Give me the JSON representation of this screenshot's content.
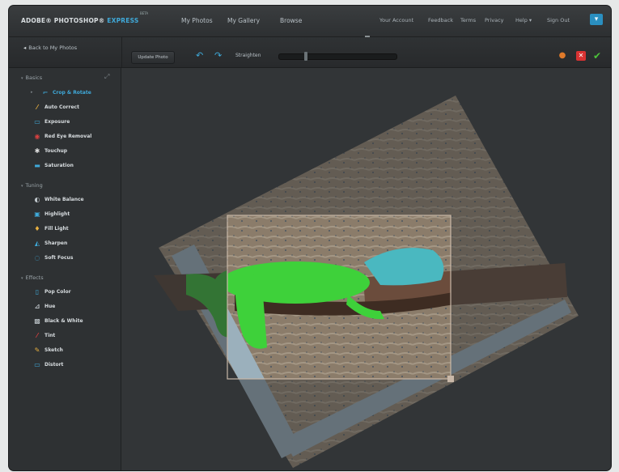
{
  "app": {
    "logo_main": "ADOBE® PHOTOSHOP®",
    "logo_express": "EXPRESS",
    "beta": "BETA"
  },
  "nav": {
    "my_photos": "My Photos",
    "my_gallery": "My Gallery",
    "browse": "Browse"
  },
  "top_links": {
    "your_account": "Your Account",
    "feedback": "Feedback",
    "terms": "Terms",
    "privacy": "Privacy",
    "help": "Help ▾",
    "sign_out": "Sign Out"
  },
  "toolbar": {
    "back": "Back to My Photos",
    "update_photo": "Update Photo",
    "straighten": "Straighten"
  },
  "sidebar": {
    "basics": "Basics",
    "crop_rotate": "Crop & Rotate",
    "auto_correct": "Auto Correct",
    "exposure": "Exposure",
    "red_eye": "Red Eye Removal",
    "touchup": "Touchup",
    "saturation": "Saturation",
    "tuning": "Tuning",
    "white_balance": "White Balance",
    "highlight": "Highlight",
    "fill_light": "Fill Light",
    "sharpen": "Sharpen",
    "soft_focus": "Soft Focus",
    "effects": "Effects",
    "pop_color": "Pop Color",
    "hue": "Hue",
    "black_white": "Black & White",
    "tint": "Tint",
    "sketch": "Sketch",
    "distort": "Distort"
  },
  "colors": {
    "accent": "#3fa9d9",
    "iguana": "#3ed13a",
    "reset": "#e07a2a",
    "cancel": "#d83232",
    "accept": "#4cc33a"
  },
  "icons": {
    "toolbar_action_1": "undo-arrow-icon",
    "toolbar_action_2": "redo-arrow-icon",
    "reset": "reset-icon",
    "cancel": "cancel-icon",
    "accept": "accept-check-icon"
  },
  "slider": {
    "straighten_fraction": 0.22
  }
}
